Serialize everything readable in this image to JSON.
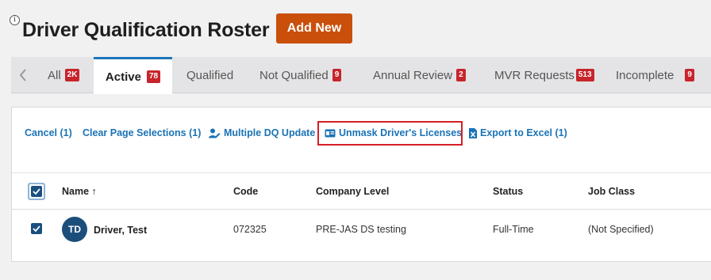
{
  "header": {
    "title": "Driver Qualification Roster",
    "add_new_label": "Add New",
    "info_icon": "info-icon"
  },
  "tabs": [
    {
      "label": "All",
      "badge": "2K"
    },
    {
      "label": "Active",
      "badge": "78",
      "active": true
    },
    {
      "label": "Qualified",
      "badge": ""
    },
    {
      "label": "Not Qualified",
      "badge": "9"
    },
    {
      "label": "Annual Review",
      "badge": "2"
    },
    {
      "label": "MVR Requests",
      "badge": "513"
    },
    {
      "label": "Incomplete",
      "badge": "9"
    }
  ],
  "toolbar": {
    "cancel": "Cancel (1)",
    "clear": "Clear Page Selections (1)",
    "multi_update": "Multiple DQ Update",
    "unmask": "Unmask Driver's Licenses",
    "export": "Export to Excel (1)"
  },
  "table": {
    "columns": {
      "name": "Name ↑",
      "code": "Code",
      "company_level": "Company Level",
      "status": "Status",
      "job_class": "Job Class"
    },
    "rows": [
      {
        "initials": "TD",
        "name": "Driver, Test",
        "code": "072325",
        "company_level": "PRE-JAS DS testing",
        "status": "Full-Time",
        "job_class": "(Not Specified)",
        "selected": true
      }
    ]
  },
  "colors": {
    "accent": "#c94f0b",
    "link": "#1a73b6",
    "badge": "#c8242b",
    "tab_active_border": "#1c76b8",
    "highlight": "#d61f26",
    "avatar": "#1c4e7c"
  }
}
